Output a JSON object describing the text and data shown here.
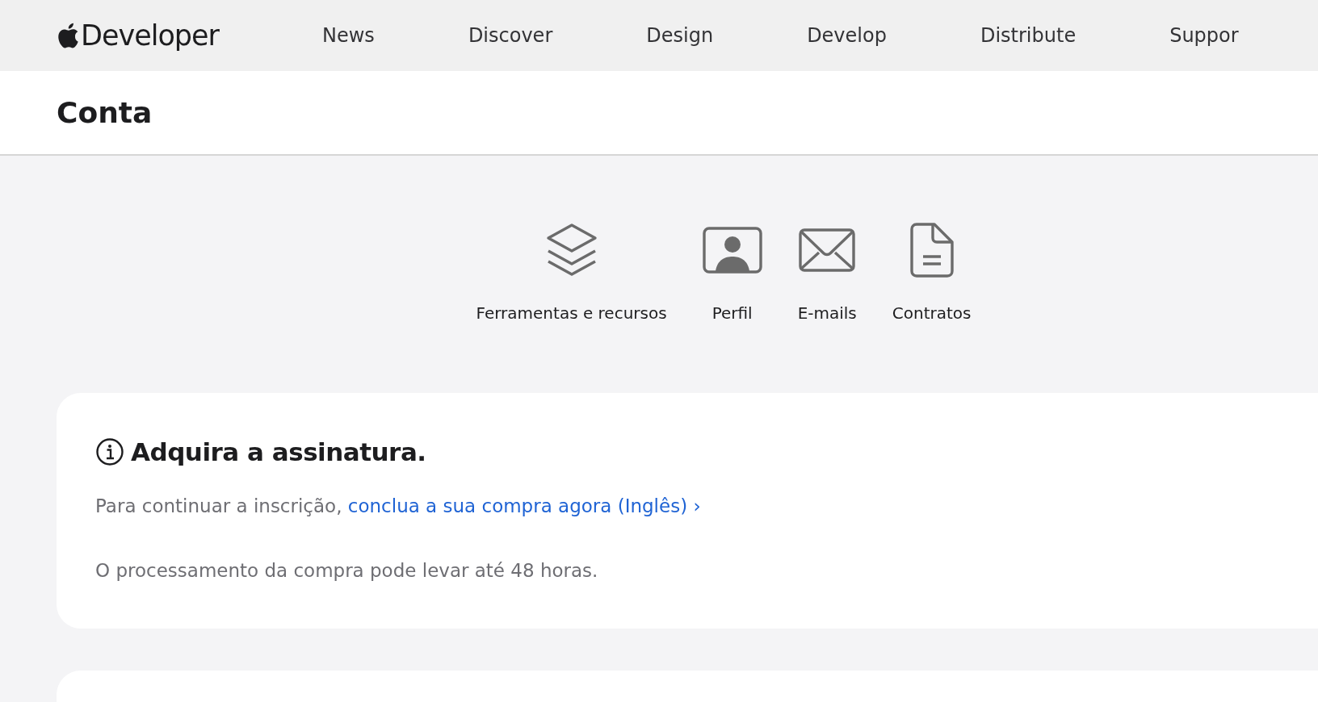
{
  "nav": {
    "logo": "Developer",
    "items": [
      "News",
      "Discover",
      "Design",
      "Develop",
      "Distribute",
      "Suppor"
    ]
  },
  "page_title": "Conta",
  "shortcuts": [
    {
      "kind": "layers",
      "label": "Ferramentas e recursos"
    },
    {
      "kind": "profile",
      "label": "Perfil"
    },
    {
      "kind": "envelope",
      "label": "E-mails"
    },
    {
      "kind": "document",
      "label": "Contratos"
    }
  ],
  "notice": {
    "title": "Adquira a assinatura.",
    "text": "Para continuar a inscrição,",
    "link": "conclua a sua compra agora (Inglês) ›",
    "note": "O processamento da compra pode levar até 48 horas."
  }
}
